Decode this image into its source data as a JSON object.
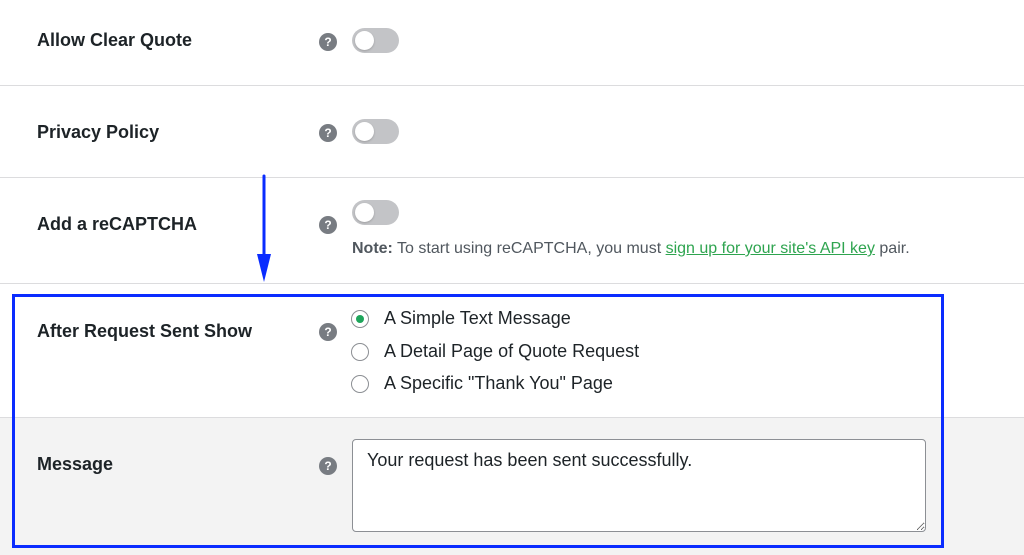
{
  "settings": {
    "allow_clear_quote": {
      "label": "Allow Clear Quote",
      "help": "?",
      "enabled": false
    },
    "privacy_policy": {
      "label": "Privacy Policy",
      "help": "?",
      "enabled": false
    },
    "recaptcha": {
      "label": "Add a reCAPTCHA",
      "help": "?",
      "enabled": false,
      "note_prefix": "Note:",
      "note_text": " To start using reCAPTCHA, you must ",
      "note_link": "sign up for your site's API key",
      "note_suffix": " pair."
    },
    "after_request": {
      "label": "After Request Sent Show",
      "help": "?",
      "options": [
        {
          "label": "A Simple Text Message",
          "checked": true
        },
        {
          "label": "A Detail Page of Quote Request",
          "checked": false
        },
        {
          "label": "A Specific \"Thank You\" Page",
          "checked": false
        }
      ]
    },
    "message": {
      "label": "Message",
      "help": "?",
      "value": "Your request has been sent successfully."
    }
  },
  "colors": {
    "toggle_off": "#c3c4c7",
    "radio_checked": "#1ea55b",
    "link": "#2ea44f",
    "highlight": "#0a2cff",
    "arrow": "#0a2cff"
  },
  "icons": {
    "help": "question-circle-icon",
    "arrow": "arrow-down-icon"
  }
}
